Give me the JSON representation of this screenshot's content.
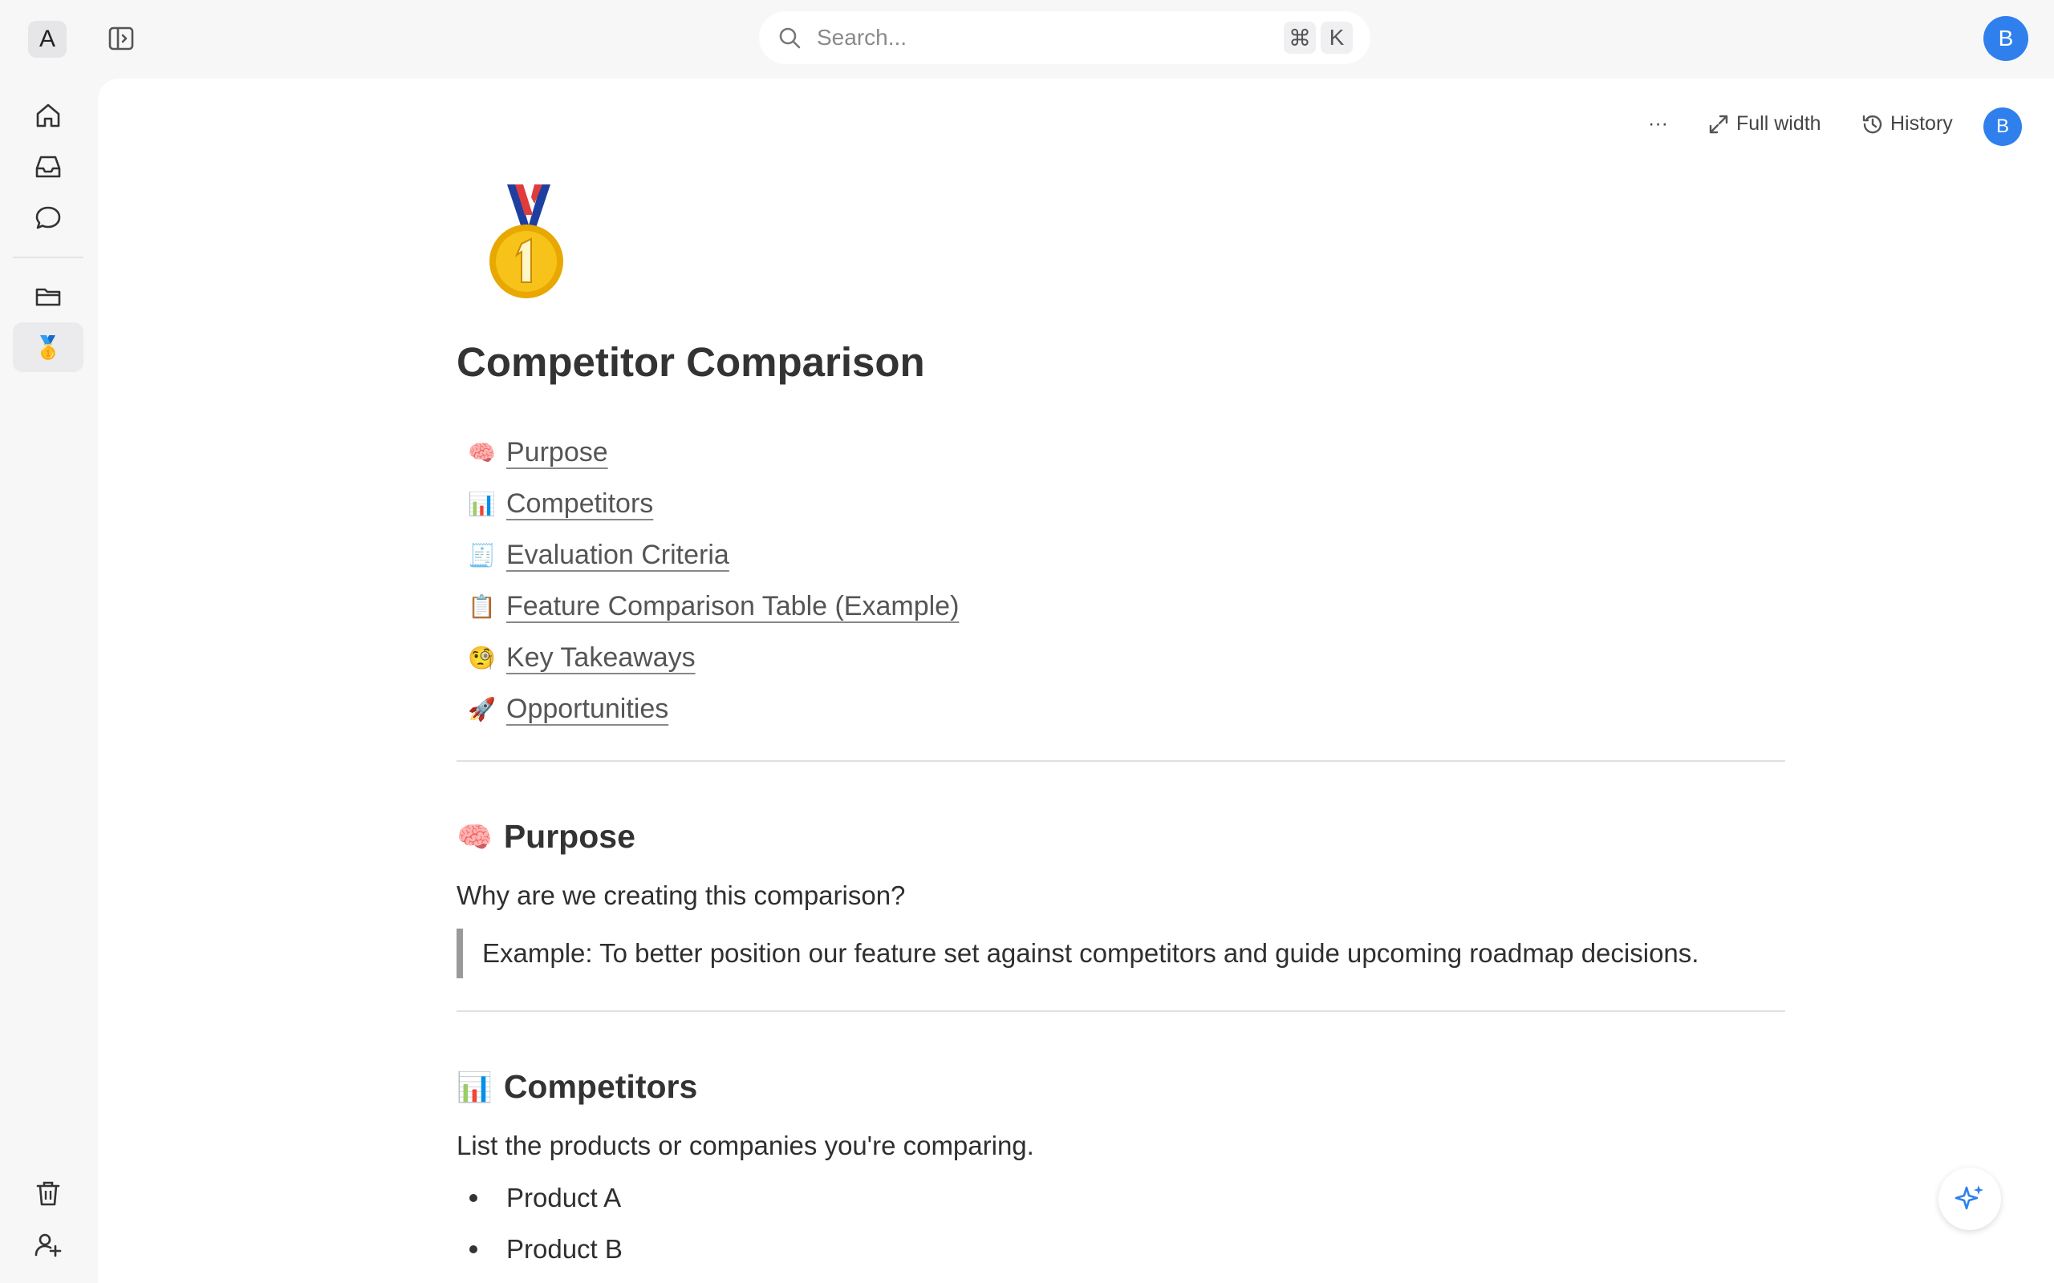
{
  "workspace": {
    "initial": "A"
  },
  "search": {
    "placeholder": "Search...",
    "shortcut_modifier": "⌘",
    "shortcut_key": "K"
  },
  "user": {
    "initial": "B",
    "avatar_color": "#2f80ed"
  },
  "sidebar": {
    "top_icons": [
      "home-icon",
      "inbox-icon",
      "chat-icon"
    ],
    "folder_icon": "folder-icon",
    "active_page_emoji": "🥇",
    "bottom_icons": [
      "trash-icon",
      "invite-user-icon"
    ]
  },
  "toolbar": {
    "more_label": "···",
    "full_width_label": "Full width",
    "history_label": "History"
  },
  "document": {
    "page_icon": "🥇",
    "title": "Competitor Comparison",
    "toc": [
      {
        "emoji": "🧠",
        "label": "Purpose"
      },
      {
        "emoji": "📊",
        "label": "Competitors"
      },
      {
        "emoji": "🧾",
        "label": "Evaluation Criteria"
      },
      {
        "emoji": "📋",
        "label": "Feature Comparison Table (Example)"
      },
      {
        "emoji": "🧐",
        "label": "Key Takeaways"
      },
      {
        "emoji": "🚀",
        "label": "Opportunities"
      }
    ],
    "purpose": {
      "emoji": "🧠",
      "heading": "Purpose",
      "text": "Why are we creating this comparison?",
      "quote": "Example: To better position our feature set against competitors and guide upcoming roadmap decisions."
    },
    "competitors": {
      "emoji": "📊",
      "heading": "Competitors",
      "text": "List the products or companies you're comparing.",
      "items": [
        "Product A",
        "Product B"
      ]
    }
  },
  "ai_button": {
    "icon": "sparkle-icon",
    "color": "#2f80ed"
  }
}
